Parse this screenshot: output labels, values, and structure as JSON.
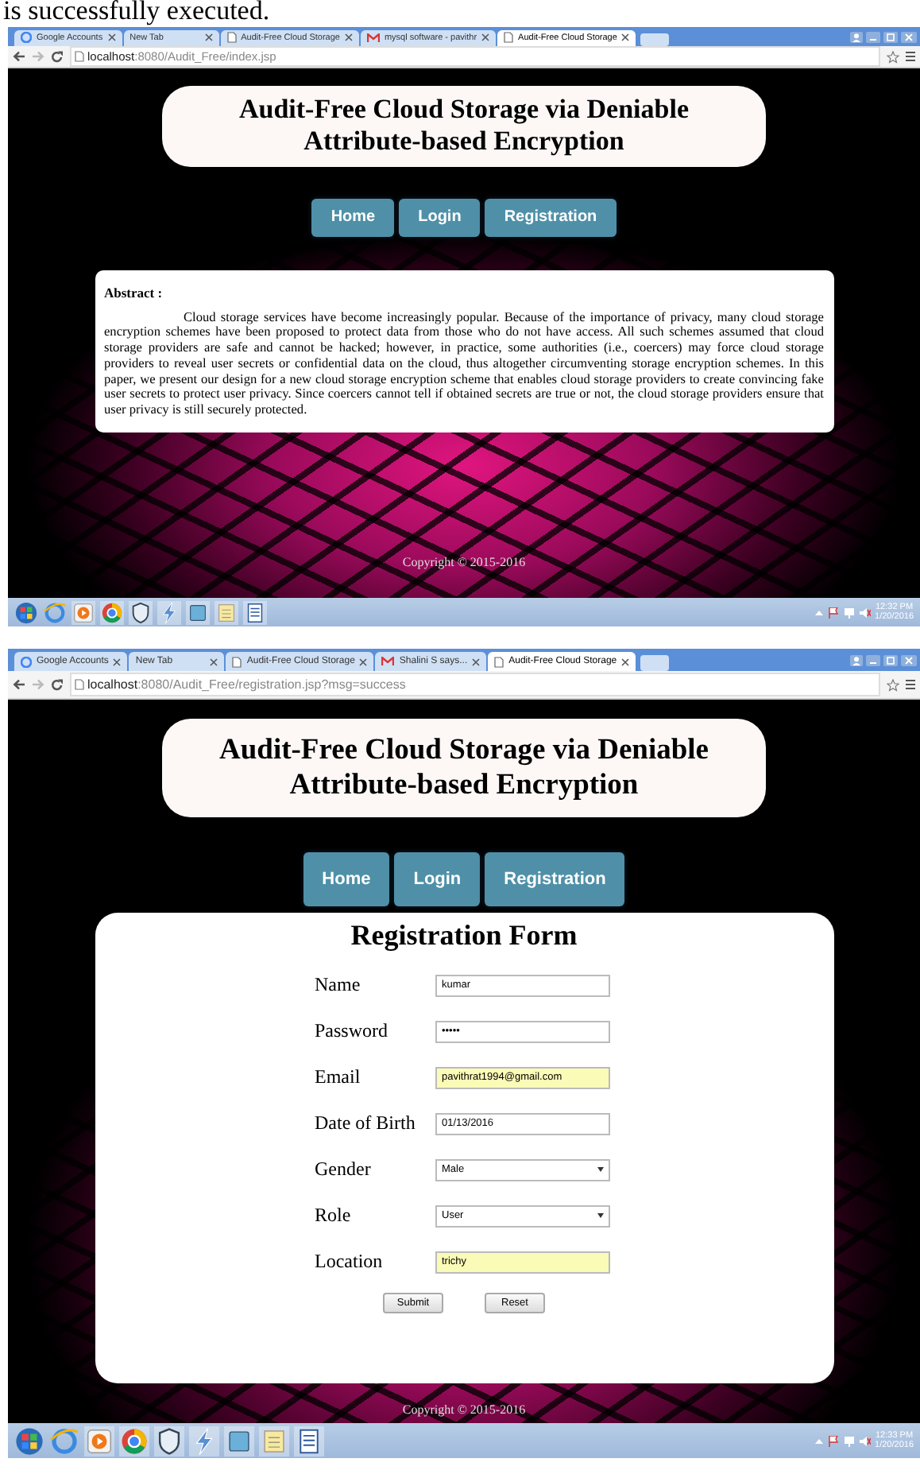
{
  "caption": "is successfully executed.",
  "screens": [
    {
      "tabs": [
        {
          "label": "Google Accounts",
          "kind": "google",
          "selected": false
        },
        {
          "label": "New Tab",
          "kind": "blank",
          "selected": false
        },
        {
          "label": "Audit-Free Cloud Storage",
          "kind": "page",
          "selected": false
        },
        {
          "label": "mysql software - pavithr",
          "kind": "mail",
          "selected": false
        },
        {
          "label": "Audit-Free Cloud Storage",
          "kind": "page",
          "selected": true
        }
      ],
      "address": {
        "host": "localhost",
        "path": ":8080/Audit_Free/index.jsp"
      },
      "page": {
        "title": "Audit-Free Cloud Storage via Deniable Attribute-based Encryption",
        "nav": [
          "Home",
          "Login",
          "Registration"
        ],
        "content": {
          "kind": "abstract",
          "heading": "Abstract :",
          "text": "Cloud storage services have become increasingly popular. Because of the importance of privacy, many cloud storage encryption schemes have been proposed to protect data from those who do not have access. All such schemes assumed that cloud storage providers are safe and cannot be hacked; however, in practice, some authorities (i.e., coercers) may force cloud storage providers to reveal user secrets or confidential data on the cloud, thus altogether circumventing storage encryption schemes. In this paper, we present our design for a new cloud storage encryption scheme that enables cloud storage providers to create convincing fake user secrets to protect user privacy. Since coercers cannot tell if obtained secrets are true or not, the cloud storage providers ensure that user privacy is still securely protected."
        },
        "footer": "Copyright © 2015-2016"
      },
      "taskbar": {
        "time": "12:32 PM",
        "date": "1/20/2016"
      }
    },
    {
      "tabs": [
        {
          "label": "Google Accounts",
          "kind": "google",
          "selected": false
        },
        {
          "label": "New Tab",
          "kind": "blank",
          "selected": false
        },
        {
          "label": "Audit-Free Cloud Storage",
          "kind": "page",
          "selected": false
        },
        {
          "label": "Shalini S says...",
          "kind": "mail",
          "selected": false
        },
        {
          "label": "Audit-Free Cloud Storage",
          "kind": "page",
          "selected": true
        }
      ],
      "address": {
        "host": "localhost",
        "path": ":8080/Audit_Free/registration.jsp?msg=success"
      },
      "page": {
        "title": "Audit-Free Cloud Storage via Deniable Attribute-based Encryption",
        "nav": [
          "Home",
          "Login",
          "Registration"
        ],
        "content": {
          "kind": "form",
          "heading": "Registration Form",
          "fields": [
            {
              "label": "Name",
              "kind": "text",
              "value": "kumar",
              "autofilled": false
            },
            {
              "label": "Password",
              "kind": "text",
              "value": "•••••",
              "autofilled": false
            },
            {
              "label": "Email",
              "kind": "text",
              "value": "pavithrat1994@gmail.com",
              "autofilled": true
            },
            {
              "label": "Date of Birth",
              "kind": "text",
              "value": "01/13/2016",
              "autofilled": false
            },
            {
              "label": "Gender",
              "kind": "select",
              "value": "Male",
              "autofilled": false
            },
            {
              "label": "Role",
              "kind": "select",
              "value": "User",
              "autofilled": false
            },
            {
              "label": "Location",
              "kind": "text",
              "value": "trichy",
              "autofilled": true
            }
          ],
          "buttons": [
            "Submit",
            "Reset"
          ]
        },
        "footer": "Copyright © 2015-2016"
      },
      "taskbar": {
        "time": "12:33 PM",
        "date": "1/20/2016"
      }
    }
  ]
}
